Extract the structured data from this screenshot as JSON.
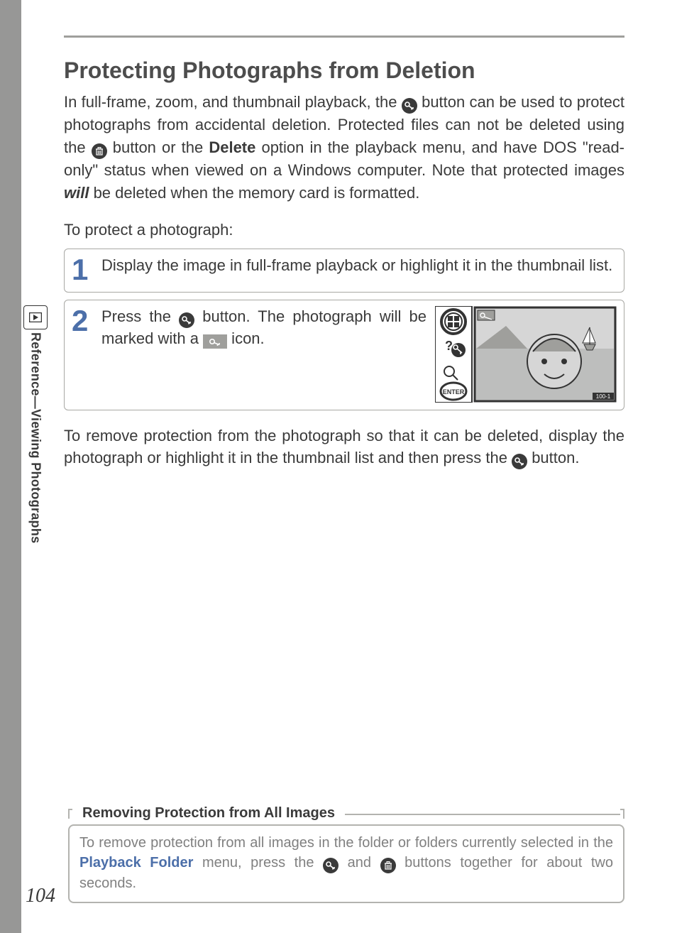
{
  "sidebar": {
    "section_label": "Reference—Viewing Photographs"
  },
  "title": "Protecting Photographs from Deletion",
  "intro": {
    "seg1": "In full-frame, zoom, and thumbnail playback, the ",
    "seg2": " button can be used to protect photographs from accidental deletion.  Protected files can not be deleted using the ",
    "seg3": " button or the ",
    "delete_word": "Delete",
    "seg4": " option in the playback menu, and have DOS \"read-only\" status when viewed on a Windows computer.  Note that protected images ",
    "will_word": "will",
    "seg5": " be deleted when the memory card is formatted."
  },
  "lead": "To protect a photograph:",
  "steps": {
    "s1": {
      "num": "1",
      "text": "Display the image in full-frame playback or highlight it in the thumbnail list."
    },
    "s2": {
      "num": "2",
      "text_a": "Press the ",
      "text_b": " button.  The photograph will be marked with a ",
      "text_c": " icon."
    }
  },
  "post": {
    "seg1": "To remove protection from the photograph so that it can be deleted, display the photograph or highlight it in the thumbnail list and then press the ",
    "seg2": " button."
  },
  "note": {
    "title": "Removing Protection from All Images",
    "seg1": "To remove protection from all images in the folder or folders currently selected in the ",
    "pf": "Playback Folder",
    "seg2": " menu, press the ",
    "seg3": " and ",
    "seg4": " buttons together for about two seconds."
  },
  "pagenum": "104",
  "illus": {
    "image_id": "100-1"
  }
}
